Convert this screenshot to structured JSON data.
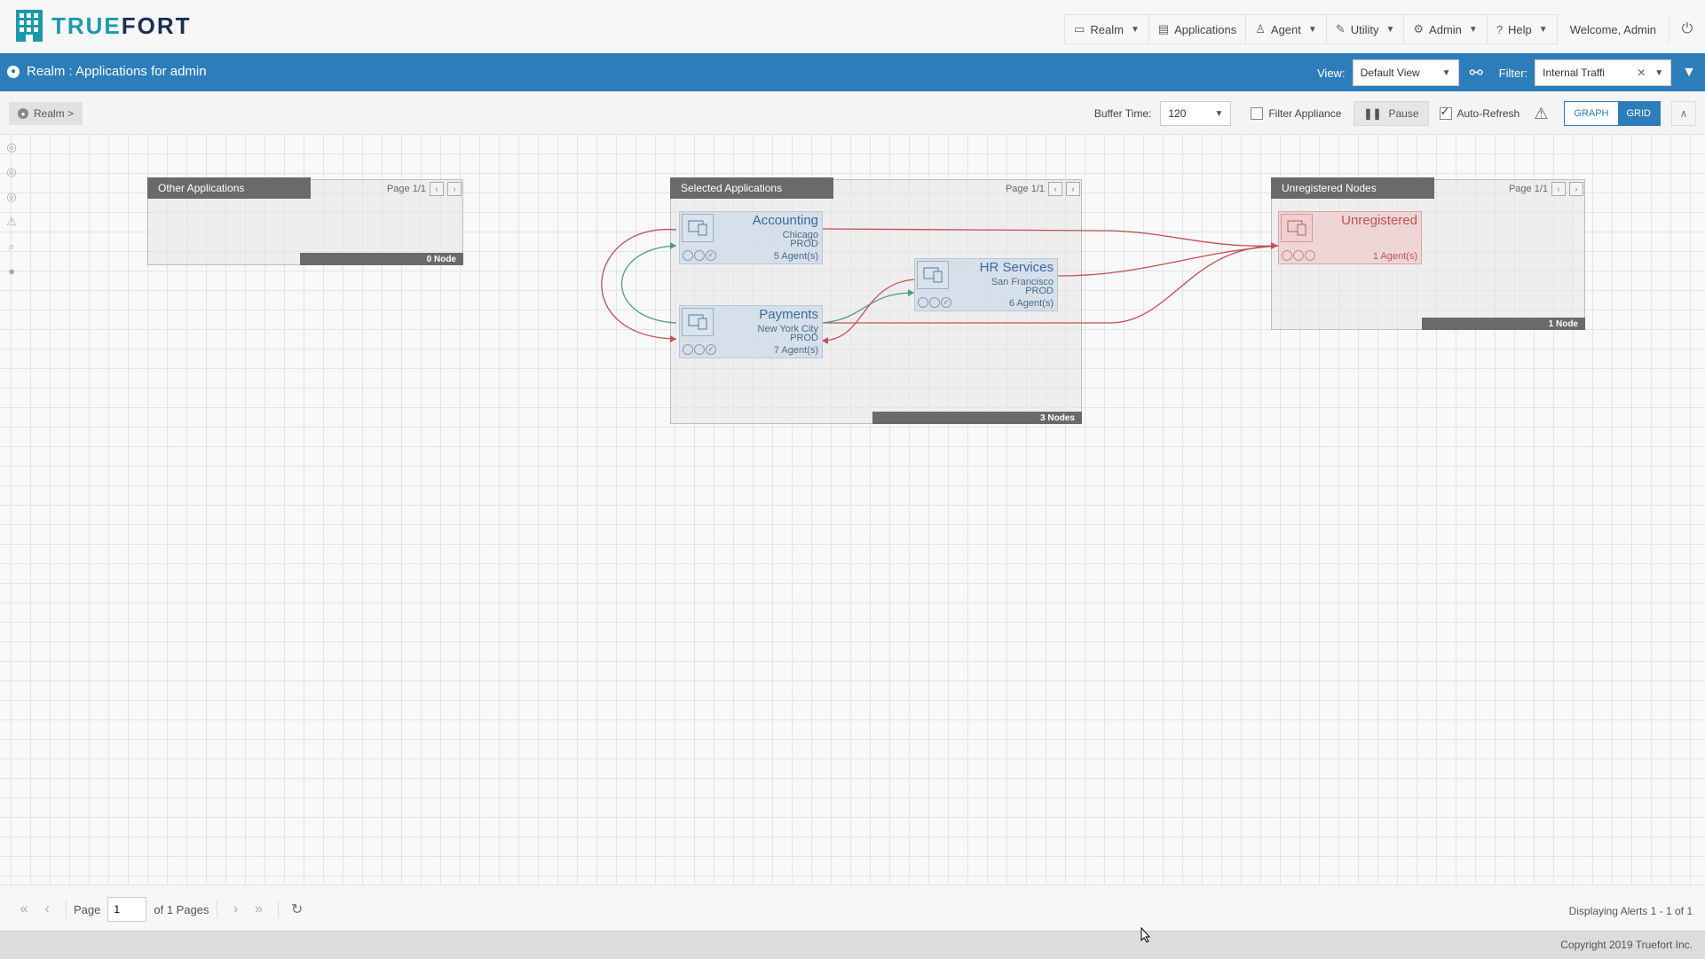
{
  "brand": {
    "name_part1": "TRUE",
    "name_part2": "FORT"
  },
  "nav": {
    "realm": "Realm",
    "applications": "Applications",
    "agent": "Agent",
    "utility": "Utility",
    "admin": "Admin",
    "help": "Help",
    "welcome": "Welcome, Admin"
  },
  "header": {
    "title": "Realm : Applications for admin",
    "view_label": "View:",
    "view_value": "Default View",
    "filter_label": "Filter:",
    "filter_value": "Internal Traffi"
  },
  "toolbar": {
    "breadcrumb": "Realm >",
    "buffer_label": "Buffer Time:",
    "buffer_value": "120",
    "filter_appliance": "Filter Appliance",
    "pause": "Pause",
    "auto_refresh": "Auto-Refresh",
    "graph": "GRAPH",
    "grid": "GRID"
  },
  "groups": {
    "other": {
      "title": "Other Applications",
      "page": "Page 1/1",
      "footer": "0 Node"
    },
    "selected": {
      "title": "Selected Applications",
      "page": "Page 1/1",
      "footer": "3 Nodes"
    },
    "unregistered": {
      "title": "Unregistered Nodes",
      "page": "Page 1/1",
      "footer": "1 Node"
    }
  },
  "nodes": {
    "accounting": {
      "name": "Accounting",
      "location": "Chicago",
      "env": "PROD",
      "agents": "5 Agent(s)"
    },
    "payments": {
      "name": "Payments",
      "location": "New York City",
      "env": "PROD",
      "agents": "7 Agent(s)"
    },
    "hr": {
      "name": "HR Services",
      "location": "San Francisco",
      "env": "PROD",
      "agents": "6 Agent(s)"
    },
    "unregistered": {
      "name": "Unregistered",
      "agents": "1 Agent(s)"
    }
  },
  "pagination": {
    "page_label": "Page",
    "page_value": "1",
    "of_pages": "of 1 Pages",
    "display": "Displaying Alerts 1 - 1 of 1"
  },
  "footer": {
    "copyright": "Copyright 2019 Truefort Inc."
  },
  "colors": {
    "accent": "#2d7dbb",
    "brand_dark": "#1b2c55",
    "brand_teal": "#1b9aaa",
    "link_red": "#c25050",
    "link_teal": "#4a9a8a"
  }
}
